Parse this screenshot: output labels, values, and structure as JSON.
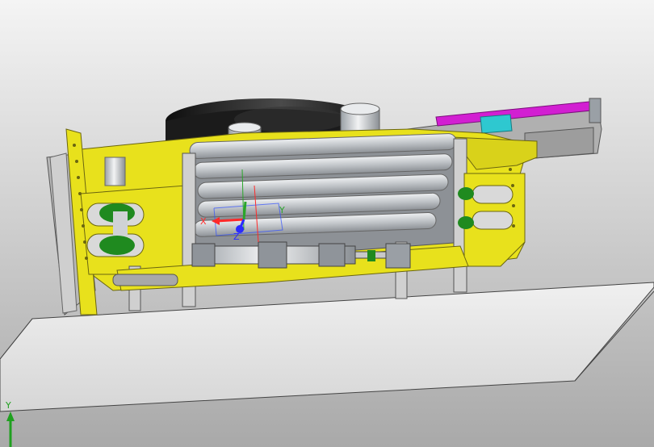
{
  "viewport": {
    "background_top": "#f4f4f4",
    "background_bottom": "#a9a9a9"
  },
  "model": {
    "frame_color": "#e8e11c",
    "roller_color": "#c9ccd0",
    "wheel_color": "#1a1a1a",
    "gear_color": "#1f8a1f",
    "rail_color": "#d21fd2",
    "block_color": "#2ec8d0",
    "steel_color": "#b8b8b8"
  },
  "triad_center": {
    "x_label": "X",
    "y_label": "Y",
    "z_label": "Z",
    "x_color": "#ff2a2a",
    "y_color": "#2aa62a",
    "z_color": "#2a2aff"
  },
  "triad_corner": {
    "y_label": "Y",
    "y_color": "#1fa01f"
  }
}
